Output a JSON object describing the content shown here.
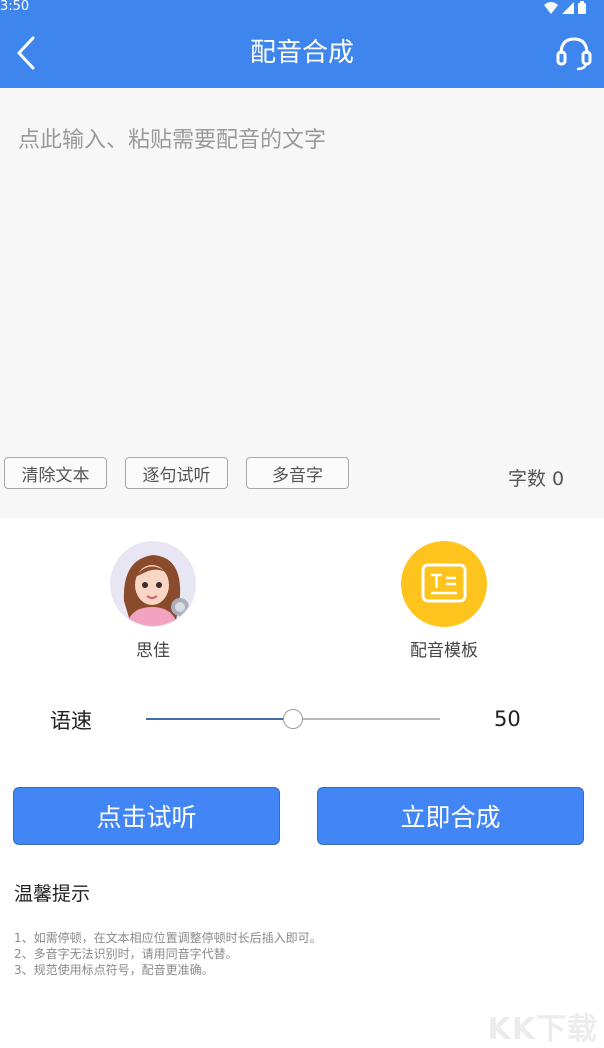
{
  "status_bar": {
    "time": "3:50"
  },
  "app_bar": {
    "title": "配音合成"
  },
  "editor": {
    "placeholder": "点此输入、粘贴需要配音的文字",
    "chips": [
      "清除文本",
      "逐句试听",
      "多音字"
    ],
    "word_count": "字数 0"
  },
  "voice": {
    "name": "思佳"
  },
  "template": {
    "label": "配音模板"
  },
  "speed": {
    "label": "语速",
    "value": "50",
    "fraction": 0.5
  },
  "buttons": {
    "preview": "点击试听",
    "synthesize": "立即合成"
  },
  "tips": {
    "title": "温馨提示",
    "lines": [
      "1、如需停顿，在文本相应位置调整停顿时长后插入即可。",
      "2、多音字无法识别时，请用同音字代替。",
      "3、规范使用标点符号，配音更准确。"
    ]
  },
  "watermark": "KK下载",
  "colors": {
    "primary": "#3e86ee",
    "button": "#4285f4",
    "template": "#ffc31e"
  }
}
